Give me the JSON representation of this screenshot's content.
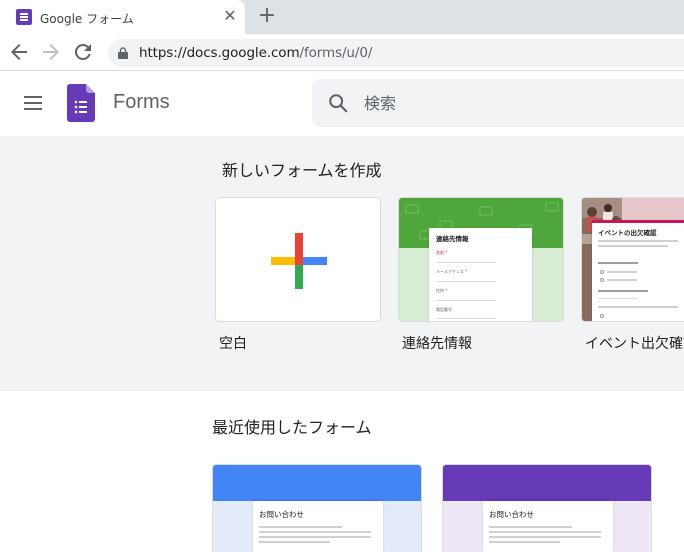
{
  "browser": {
    "tab_title": "Google フォーム",
    "close_glyph": "✕",
    "new_tab_glyph": "+",
    "url_host": "https://docs.google.com",
    "url_path": "/forms/u/0/"
  },
  "app": {
    "name": "Forms",
    "brand_color": "#673ab7",
    "search_placeholder": "検索"
  },
  "gallery": {
    "title": "新しいフォームを作成",
    "templates": [
      {
        "label": "空白",
        "icon": "plus-multicolor-icon"
      },
      {
        "label": "連絡先情報",
        "preview_title": "連絡先情報",
        "preview_fields": [
          "名前 *",
          "メールアドレス *",
          "住所 *",
          "電話番号"
        ],
        "accent": "#4fa73b"
      },
      {
        "label": "イベント出欠確認",
        "preview_title": "イベントの出欠確認",
        "accent": "#c2185b"
      }
    ]
  },
  "recent": {
    "title": "最近使用したフォーム",
    "forms": [
      {
        "preview_title": "お問い合わせ",
        "band_color": "#4285f4",
        "lower_color": "#e3ebfb"
      },
      {
        "preview_title": "お問い合わせ",
        "band_color": "#673ab7",
        "lower_color": "#ede7f6"
      }
    ]
  }
}
